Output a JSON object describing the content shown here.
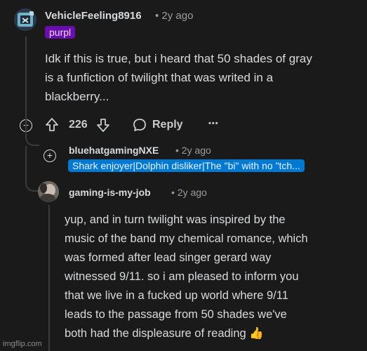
{
  "comment1": {
    "username": "VehicleFeeling8916",
    "time": "• 2y ago",
    "flair": "purpl",
    "flair_bg": "#6a0dad",
    "lines": [
      "Idk if this is true, but i heard that 50 shades of gray",
      "is a funfiction of twilight that was writed in a",
      "blackberry..."
    ],
    "votes": "226",
    "reply_label": "Reply",
    "more_label": "•••"
  },
  "comment2": {
    "username": "bluehatgamingNXE",
    "time": "• 2y ago",
    "flair": "Shark enjoyer|Dolphin disliker|The \"bi\" with no \"tch...",
    "flair_bg": "#0079d3"
  },
  "comment3": {
    "username": "gaming-is-my-job",
    "time": "• 2y ago",
    "lines": [
      "yup, and in turn twilight was inspired by the",
      "music of the band my chemical romance, which",
      "was formed after lead singer gerard way",
      "witnessed 9/11. so i am pleased to inform you",
      "that we live in a fucked up world where 9/11",
      "leads to the passage from 50 shades we've",
      "both had the displeasure of reading"
    ],
    "emoji": "👍"
  },
  "watermark": "imgflip.com"
}
